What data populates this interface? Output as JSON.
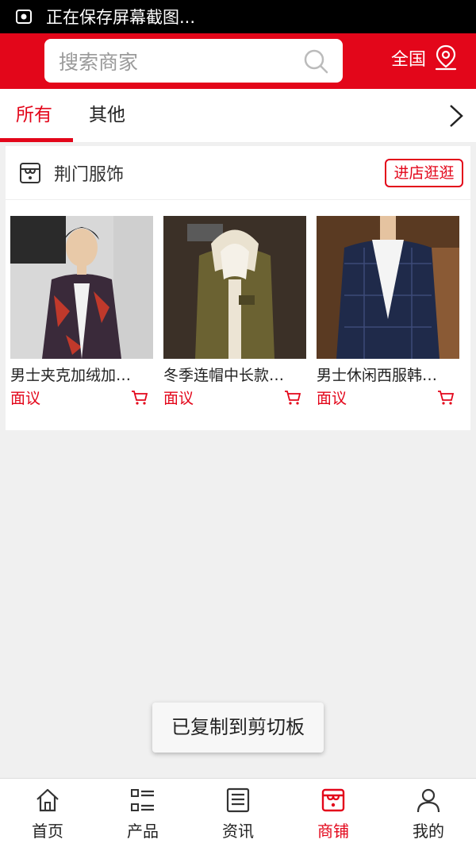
{
  "status_bar": {
    "text": "正在保存屏幕截图..."
  },
  "header": {
    "search_placeholder": "搜索商家",
    "region_label": "全国"
  },
  "tabs": [
    {
      "label": "所有",
      "active": true
    },
    {
      "label": "其他",
      "active": false
    }
  ],
  "shop": {
    "name": "荆门服饰",
    "visit_label": "进店逛逛",
    "products": [
      {
        "title": "男士夹克加绒加…",
        "price": "面议"
      },
      {
        "title": "冬季连帽中长款…",
        "price": "面议"
      },
      {
        "title": "男士休闲西服韩…",
        "price": "面议"
      }
    ]
  },
  "toast": {
    "text": "已复制到剪切板"
  },
  "bottom_nav": [
    {
      "label": "首页",
      "icon": "home-icon",
      "active": false
    },
    {
      "label": "产品",
      "icon": "list-icon",
      "active": false
    },
    {
      "label": "资讯",
      "icon": "news-icon",
      "active": false
    },
    {
      "label": "商铺",
      "icon": "store-icon",
      "active": true
    },
    {
      "label": "我的",
      "icon": "user-icon",
      "active": false
    }
  ],
  "colors": {
    "accent": "#e3061a",
    "background": "#f0f0f0"
  }
}
